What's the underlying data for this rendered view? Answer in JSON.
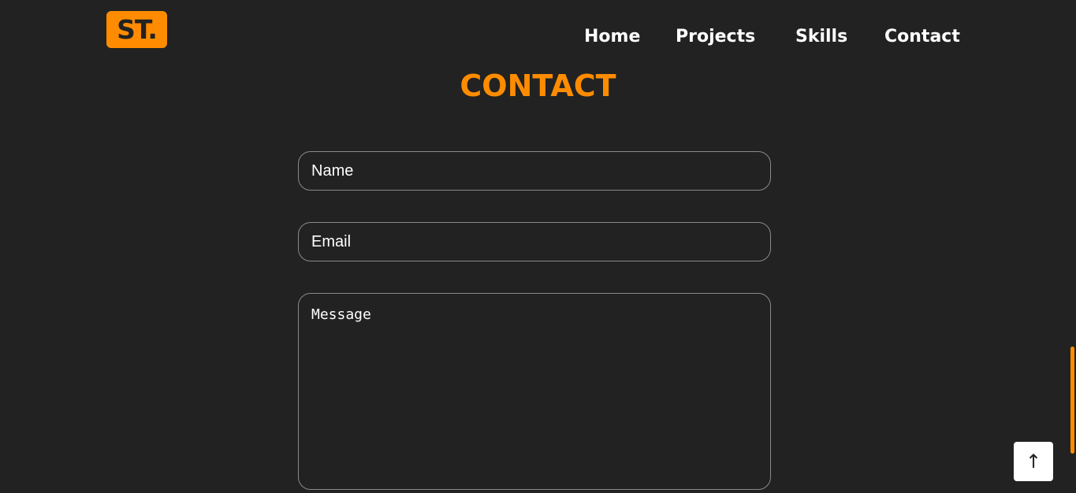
{
  "header": {
    "logo_text": "ST.",
    "nav": {
      "home": "Home",
      "projects": "Projects",
      "skills": "Skills",
      "contact": "Contact"
    }
  },
  "contact": {
    "title": "CONTACT",
    "name_placeholder": "Name",
    "email_placeholder": "Email",
    "message_placeholder": "Message"
  },
  "back_to_top": {
    "icon": "arrow-up-icon",
    "glyph": "↑"
  },
  "colors": {
    "background": "#222222",
    "accent": "#ff8c00",
    "text": "#ffffff",
    "field_border": "#8a8a8a"
  }
}
